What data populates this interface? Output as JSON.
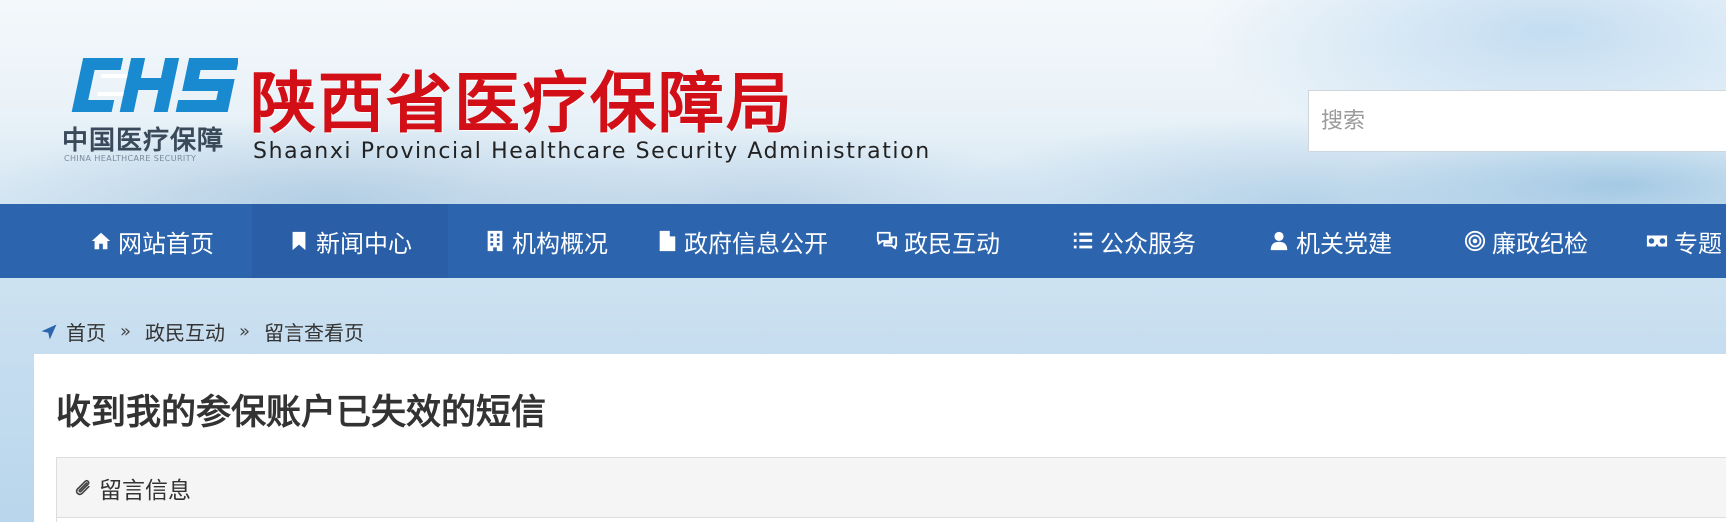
{
  "header": {
    "logo_mark": "CHS",
    "logo_cn": "中国医疗保障",
    "logo_en": "CHINA HEALTHCARE SECURITY",
    "title": "陕西省医疗保障局",
    "subtitle": "Shaanxi Provincial Healthcare Security Administration",
    "search_placeholder": "搜索",
    "search_value": "",
    "colors": {
      "title": "#d20f16",
      "logo_blue": "#1a8ad0",
      "nav_bg": "#2c64ae"
    }
  },
  "nav": {
    "items": [
      {
        "label": "网站首页",
        "icon": "home-icon"
      },
      {
        "label": "新闻中心",
        "icon": "bookmark-icon"
      },
      {
        "label": "机构概况",
        "icon": "building-icon"
      },
      {
        "label": "政府信息公开",
        "icon": "document-icon"
      },
      {
        "label": "政民互动",
        "icon": "chat-bubbles-icon"
      },
      {
        "label": "公众服务",
        "icon": "list-icon"
      },
      {
        "label": "机关党建",
        "icon": "user-icon"
      },
      {
        "label": "廉政纪检",
        "icon": "target-icon"
      },
      {
        "label": "专题",
        "icon": "glasses-icon"
      }
    ]
  },
  "breadcrumb": {
    "icon": "location-arrow-icon",
    "items": [
      "首页",
      "政民互动",
      "留言查看页"
    ],
    "separator": "»"
  },
  "main": {
    "title": "收到我的参保账户已失效的短信",
    "panel": {
      "icon": "paperclip-icon",
      "heading": "留言信息"
    }
  }
}
